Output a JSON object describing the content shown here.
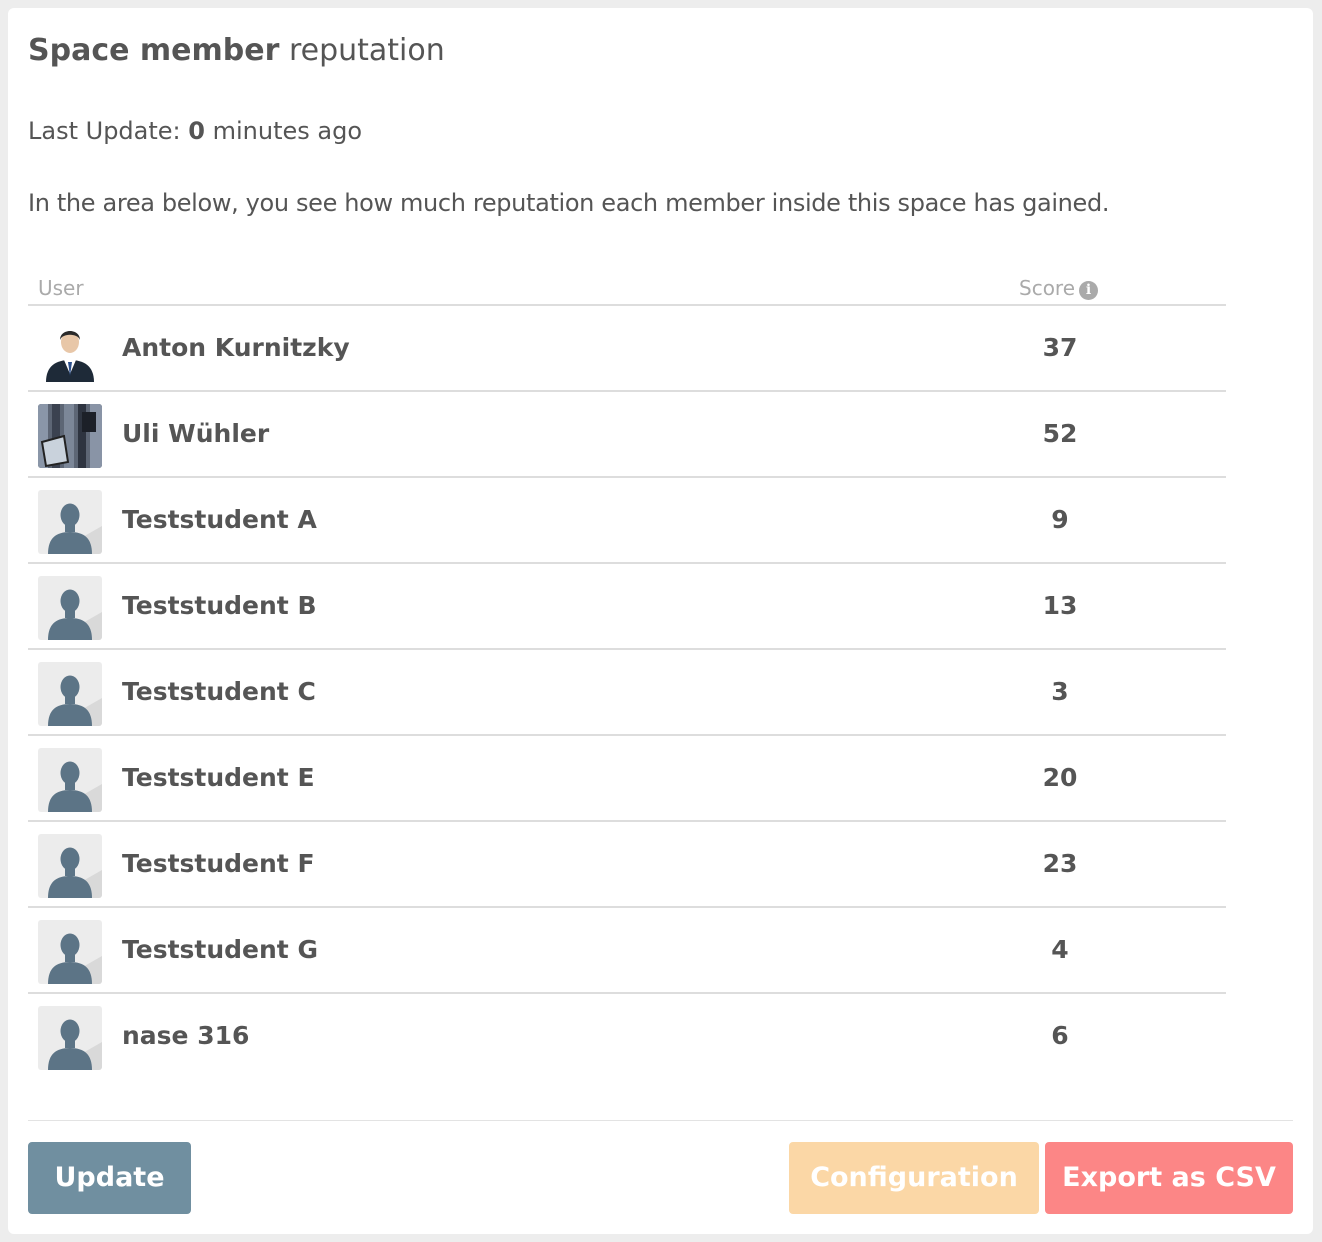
{
  "header": {
    "title_strong": "Space member",
    "title_light": "reputation"
  },
  "status": {
    "last_update_label": "Last Update:",
    "last_update_value": "0",
    "last_update_suffix": "minutes ago"
  },
  "description": "In the area below, you see how much reputation each member inside this space has gained.",
  "table": {
    "col_user": "User",
    "col_score": "Score",
    "rows": [
      {
        "name": "Anton Kurnitzky",
        "score": "37",
        "avatar": "businessman-avatar"
      },
      {
        "name": "Uli Wühler",
        "score": "52",
        "avatar": "building-photo-avatar"
      },
      {
        "name": "Teststudent A",
        "score": "9",
        "avatar": "default-user-avatar"
      },
      {
        "name": "Teststudent B",
        "score": "13",
        "avatar": "default-user-avatar"
      },
      {
        "name": "Teststudent C",
        "score": "3",
        "avatar": "default-user-avatar"
      },
      {
        "name": "Teststudent E",
        "score": "20",
        "avatar": "default-user-avatar"
      },
      {
        "name": "Teststudent F",
        "score": "23",
        "avatar": "default-user-avatar"
      },
      {
        "name": "Teststudent G",
        "score": "4",
        "avatar": "default-user-avatar"
      },
      {
        "name": "nase 316",
        "score": "6",
        "avatar": "default-user-avatar"
      }
    ]
  },
  "buttons": {
    "update": "Update",
    "configuration": "Configuration",
    "export": "Export as CSV"
  },
  "colors": {
    "update_button": "#708fa0",
    "configuration_button": "#fbd7a6",
    "export_button": "#fc8686",
    "text": "#555555",
    "header_text": "#aaaaaa"
  }
}
